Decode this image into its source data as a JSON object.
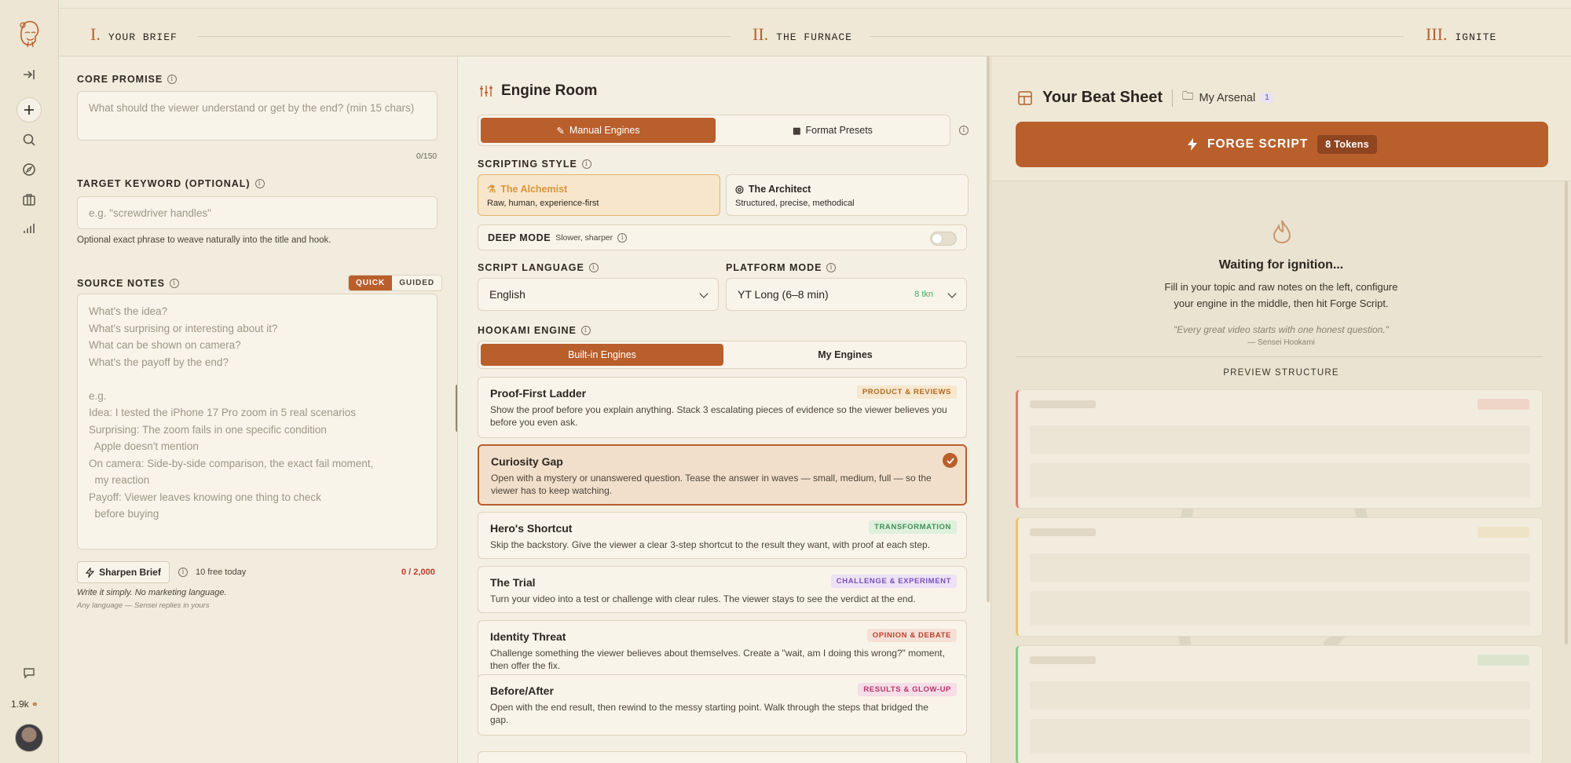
{
  "rail": {
    "icons": [
      "logo-sensei",
      "sidebar-expand-icon",
      "plus-icon",
      "search-icon",
      "compass-icon",
      "briefcase-icon",
      "chart-icon",
      "chat-icon"
    ],
    "credits": "1.9k"
  },
  "steps": [
    {
      "numeral": "I.",
      "label": "YOUR BRIEF"
    },
    {
      "numeral": "II.",
      "label": "THE FURNACE"
    },
    {
      "numeral": "III.",
      "label": "IGNITE"
    }
  ],
  "left": {
    "core_promise": {
      "label": "CORE PROMISE",
      "placeholder": "What should the viewer understand or get by the end? (min 15 chars)",
      "counter": "0/150"
    },
    "target_keyword": {
      "label": "TARGET KEYWORD (OPTIONAL)",
      "placeholder": "e.g. \"screwdriver handles\"",
      "hint": "Optional exact phrase to weave naturally into the title and hook."
    },
    "source_notes": {
      "label": "SOURCE NOTES",
      "mode_quick": "QUICK",
      "mode_guided": "GUIDED",
      "placeholder_lines": [
        "What's the idea?",
        "What's surprising or interesting about it?",
        "What can be shown on camera?",
        "What's the payoff by the end?",
        "",
        "e.g.",
        "Idea: I tested the iPhone 17 Pro zoom in 5 real scenarios",
        "Surprising: The zoom fails in one specific condition",
        "  Apple doesn't mention",
        "On camera: Side-by-side comparison, the exact fail moment,",
        "  my reaction",
        "Payoff: Viewer leaves knowing one thing to check",
        "  before buying"
      ],
      "sharpen_label": "Sharpen Brief",
      "free_today": "10 free today",
      "char_count": "0 / 2,000",
      "tip": "Write it simply. No marketing language.",
      "tip_sub": "Any language — Sensei replies in yours"
    }
  },
  "mid": {
    "title": "Engine Room",
    "tab_manual": "Manual Engines",
    "tab_presets": "Format Presets",
    "scripting_style_label": "SCRIPTING STYLE",
    "styles": [
      {
        "title": "The Alchemist",
        "subtitle": "Raw, human, experience-first",
        "selected": true
      },
      {
        "title": "The Architect",
        "subtitle": "Structured, precise, methodical",
        "selected": false
      }
    ],
    "deep_mode": {
      "label": "DEEP MODE",
      "sub": "Slower, sharper",
      "on": false
    },
    "script_language": {
      "label": "SCRIPT LANGUAGE",
      "value": "English"
    },
    "platform_mode": {
      "label": "PLATFORM MODE",
      "value": "YT Long (6–8 min)",
      "tokens": "8 tkn"
    },
    "hookami_label": "HOOKAMI ENGINE",
    "engine_tab_builtin": "Built-in Engines",
    "engine_tab_mine": "My Engines",
    "engines": [
      {
        "name": "Proof-First Ladder",
        "tag": "PRODUCT & REVIEWS",
        "tag_color": "#b06a1e",
        "tag_bg": "#f6e7cf",
        "desc": "Show the proof before you explain anything. Stack 3 escalating pieces of evidence so the viewer believes you before you even ask."
      },
      {
        "name": "Curiosity Gap",
        "tag": "",
        "selected": true,
        "desc": "Open with a mystery or unanswered question. Tease the answer in waves — small, medium, full — so the viewer has to keep watching."
      },
      {
        "name": "Hero's Shortcut",
        "tag": "TRANSFORMATION",
        "tag_color": "#3f8f55",
        "tag_bg": "#dff0dc",
        "desc": "Skip the backstory. Give the viewer a clear 3-step shortcut to the result they want, with proof at each step."
      },
      {
        "name": "The Trial",
        "tag": "CHALLENGE & EXPERIMENT",
        "tag_color": "#7a4fb8",
        "tag_bg": "#ece2f6",
        "desc": "Turn your video into a test or challenge with clear rules. The viewer stays to see the verdict at the end."
      },
      {
        "name": "Identity Threat",
        "tag": "OPINION & DEBATE",
        "tag_color": "#b8402c",
        "tag_bg": "#f6e0d6",
        "desc": "Challenge something the viewer believes about themselves. Create a \"wait, am I doing this wrong?\" moment, then offer the fix."
      },
      {
        "name": "Before/After",
        "tag": "RESULTS & GLOW-UP",
        "tag_color": "#b8336b",
        "tag_bg": "#f6dde6",
        "desc": "Open with the end result, then rewind to the messy starting point. Walk through the steps that bridged the gap."
      }
    ]
  },
  "right": {
    "title": "Your Beat Sheet",
    "arsenal_label": "My Arsenal",
    "arsenal_count": "1",
    "forge_label": "FORGE SCRIPT",
    "forge_tokens": "8 Tokens",
    "waiting_title": "Waiting for ignition...",
    "waiting_body": "Fill in your topic and raw notes on the left, configure your engine in the middle, then hit Forge Script.",
    "quote": "\"Every great video starts with one honest question.\"",
    "quote_author": "— Sensei Hookami",
    "preview_label": "PREVIEW STRUCTURE",
    "skeleton_accents": [
      "#e07c70",
      "#e8c46a",
      "#8cc98a"
    ]
  },
  "colors": {
    "accent": "#b95f2c",
    "bg": "#efe9da"
  }
}
